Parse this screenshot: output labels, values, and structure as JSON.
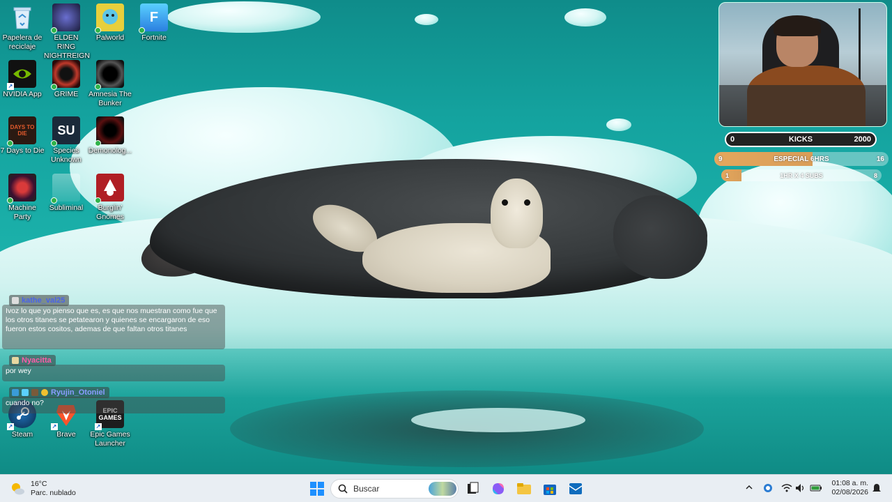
{
  "desktop": {
    "icons": [
      {
        "label": "Papelera de reciclaje",
        "icon": "recycle-bin-icon"
      },
      {
        "label": "ELDEN RING NIGHTREIGN",
        "icon": "elden-ring-icon"
      },
      {
        "label": "Palworld",
        "icon": "palworld-icon"
      },
      {
        "label": "Fortnite",
        "icon": "fortnite-icon"
      },
      {
        "label": "NVIDIA App",
        "icon": "nvidia-icon"
      },
      {
        "label": "GRIME",
        "icon": "grime-icon"
      },
      {
        "label": "Amnesia The Bunker",
        "icon": "amnesia-icon"
      },
      {
        "label": "7 Days to Die",
        "icon": "7-days-icon"
      },
      {
        "label": "Species Unknown",
        "icon": "species-unknown-icon"
      },
      {
        "label": "Demonolog...",
        "icon": "demonologist-icon"
      },
      {
        "label": "Machine Party",
        "icon": "machine-party-icon"
      },
      {
        "label": "Subliminal",
        "icon": "subliminal-icon"
      },
      {
        "label": "Burglin' Gnomes",
        "icon": "burglin-gnomes-icon"
      },
      {
        "label": "Steam",
        "icon": "steam-icon"
      },
      {
        "label": "Brave",
        "icon": "brave-icon"
      },
      {
        "label": "Epic Games Launcher",
        "icon": "epic-games-icon"
      }
    ],
    "fortnite_glyph": "F",
    "sevendays_glyph": "DAYS TO DIE",
    "species_glyph": "SU",
    "epic_glyph": "EPIC GAMES"
  },
  "goals": {
    "kicks": {
      "label": "KICKS",
      "current": "0",
      "target": "2000",
      "progress": 0
    },
    "especial": {
      "label": "ESPECIAL 6HRS",
      "current": "9",
      "target": "16",
      "progress": 0.5625
    },
    "subs": {
      "label": "1HR X 4 SUBS",
      "current": "1",
      "target": "8",
      "progress": 0.125
    }
  },
  "chat": {
    "messages": [
      {
        "user": "kathe_val25",
        "user_color": "#4a63e8",
        "text": "Ivoz lo que yo pienso que es, es que nos muestran como fue que los otros titanes se petatearon y quienes se encargaron de eso fueron estos cositos, ademas de que faltan otros titanes"
      },
      {
        "user": "Nyacitta",
        "user_color": "#ff5ca8",
        "text": "por wey"
      },
      {
        "user": "Ryujin_Otoniel",
        "user_color": "#8a9cff",
        "text": "cuando no?"
      }
    ]
  },
  "taskbar": {
    "weather": {
      "temp": "16°C",
      "desc": "Parc. nublado"
    },
    "search_placeholder": "Buscar",
    "time": "01:08 a. m.",
    "date": "02/08/2026"
  },
  "colors": {
    "taskbar_bg": "#e9eef3",
    "goal_fill": "#e4a75d",
    "accent": "#0078d4"
  }
}
